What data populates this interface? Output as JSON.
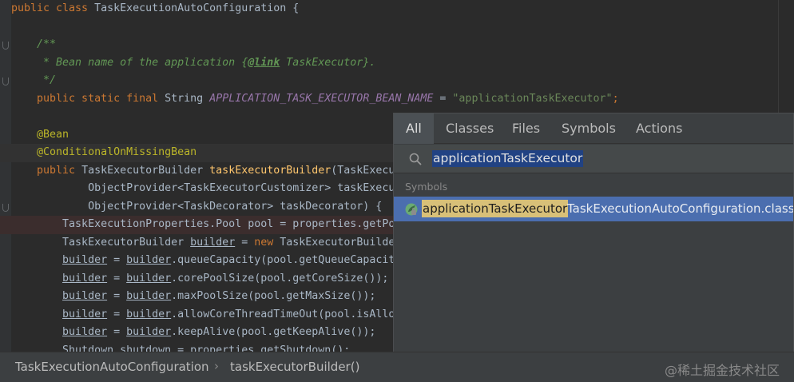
{
  "editor": {
    "lines": [
      {
        "parts": [
          {
            "t": "public class ",
            "c": "kw"
          },
          {
            "t": "TaskExecutionAutoConfiguration {",
            "c": ""
          }
        ]
      },
      {
        "parts": []
      },
      {
        "parts": [
          {
            "t": "    /**",
            "c": "cm"
          }
        ]
      },
      {
        "parts": [
          {
            "t": "     * Bean name of the application {",
            "c": "cm"
          },
          {
            "t": "@link",
            "c": "cm-tag"
          },
          {
            "t": " TaskExecutor}.",
            "c": "cm"
          }
        ]
      },
      {
        "parts": [
          {
            "t": "     */",
            "c": "cm"
          }
        ]
      },
      {
        "parts": [
          {
            "t": "    public static final ",
            "c": "kw"
          },
          {
            "t": "String ",
            "c": ""
          },
          {
            "t": "APPLICATION_TASK_EXECUTOR_BEAN_NAME",
            "c": "const"
          },
          {
            "t": " = ",
            "c": ""
          },
          {
            "t": "\"applicationTaskExecutor\"",
            "c": "str"
          },
          {
            "t": ";",
            "c": "kw"
          }
        ]
      },
      {
        "parts": []
      },
      {
        "parts": [
          {
            "t": "    @Bean",
            "c": "ann"
          }
        ]
      },
      {
        "parts": [
          {
            "t": "    @ConditionalOnMissingBean",
            "c": "ann"
          }
        ]
      },
      {
        "parts": [
          {
            "t": "    public ",
            "c": "kw"
          },
          {
            "t": "TaskExecutorBuilder ",
            "c": ""
          },
          {
            "t": "taskExecutorBuilder",
            "c": "meth"
          },
          {
            "t": "(TaskExecu",
            "c": ""
          }
        ]
      },
      {
        "parts": [
          {
            "t": "            ObjectProvider<TaskExecutorCustomizer> taskExecu",
            "c": ""
          }
        ]
      },
      {
        "parts": [
          {
            "t": "            ObjectProvider<TaskDecorator> taskDecorator) {",
            "c": ""
          }
        ]
      },
      {
        "parts": [
          {
            "t": "        TaskExecutionProperties.Pool pool = properties.getPo",
            "c": ""
          }
        ]
      },
      {
        "parts": [
          {
            "t": "        TaskExecutorBuilder ",
            "c": ""
          },
          {
            "t": "builder",
            "c": "var"
          },
          {
            "t": " = ",
            "c": ""
          },
          {
            "t": "new ",
            "c": "kw"
          },
          {
            "t": "TaskExecutorBuilde",
            "c": ""
          }
        ]
      },
      {
        "parts": [
          {
            "t": "        ",
            "c": ""
          },
          {
            "t": "builder",
            "c": "var"
          },
          {
            "t": " = ",
            "c": ""
          },
          {
            "t": "builder",
            "c": "var"
          },
          {
            "t": ".queueCapacity(pool.getQueueCapacit",
            "c": ""
          }
        ]
      },
      {
        "parts": [
          {
            "t": "        ",
            "c": ""
          },
          {
            "t": "builder",
            "c": "var"
          },
          {
            "t": " = ",
            "c": ""
          },
          {
            "t": "builder",
            "c": "var"
          },
          {
            "t": ".corePoolSize(pool.getCoreSize());",
            "c": ""
          }
        ]
      },
      {
        "parts": [
          {
            "t": "        ",
            "c": ""
          },
          {
            "t": "builder",
            "c": "var"
          },
          {
            "t": " = ",
            "c": ""
          },
          {
            "t": "builder",
            "c": "var"
          },
          {
            "t": ".maxPoolSize(pool.getMaxSize());",
            "c": ""
          }
        ]
      },
      {
        "parts": [
          {
            "t": "        ",
            "c": ""
          },
          {
            "t": "builder",
            "c": "var"
          },
          {
            "t": " = ",
            "c": ""
          },
          {
            "t": "builder",
            "c": "var"
          },
          {
            "t": ".allowCoreThreadTimeOut(pool.isAllo",
            "c": ""
          }
        ]
      },
      {
        "parts": [
          {
            "t": "        ",
            "c": ""
          },
          {
            "t": "builder",
            "c": "var"
          },
          {
            "t": " = ",
            "c": ""
          },
          {
            "t": "builder",
            "c": "var"
          },
          {
            "t": ".keepAlive(pool.getKeepAlive());",
            "c": ""
          }
        ]
      },
      {
        "parts": [
          {
            "t": "        Shutdown shutdown = properties.getShutdown();",
            "c": ""
          }
        ]
      }
    ]
  },
  "popup": {
    "tabs": [
      "All",
      "Classes",
      "Files",
      "Symbols",
      "Actions"
    ],
    "search_value": "applicationTaskExecutor",
    "section": "Symbols",
    "result": {
      "name": "applicationTaskExecutor",
      "class_name": "TaskExecutionAutoConfiguration.class"
    }
  },
  "breadcrumbs": {
    "first": "TaskExecutionAutoConfiguration",
    "separator": "›",
    "second": "taskExecutorBuilder()"
  },
  "watermark": "@稀土掘金技术社区",
  "icons": {
    "search": "search-icon",
    "result": "spring-bean-icon"
  },
  "colors": {
    "selection": "#4b6eaf",
    "match_highlight": "#d8c078",
    "editor_bg": "#2b2b2b"
  }
}
